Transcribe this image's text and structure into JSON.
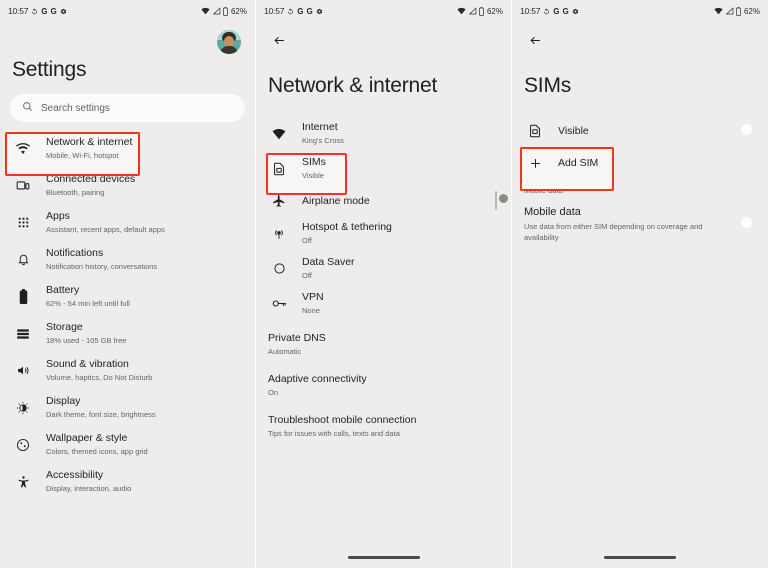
{
  "statusbar": {
    "time": "10:57",
    "battery_pct": "62%",
    "left_icons": [
      "rotate-icon",
      "google-g-icon",
      "google-g-icon",
      "gear-icon"
    ],
    "right_icons": [
      "wifi-icon",
      "signal-icon",
      "battery-icon"
    ]
  },
  "colors": {
    "background": "#eeedeb",
    "highlight_red": "#f4331f",
    "toggle_on": "#3f5257",
    "text_primary": "#1f1f1f",
    "text_secondary": "#636363"
  },
  "screen1": {
    "title": "Settings",
    "search": {
      "placeholder": "Search settings",
      "icon": "search-icon"
    },
    "avatar": "account-avatar",
    "items": [
      {
        "icon": "wifi-icon",
        "title": "Network & internet",
        "subtitle": "Mobile, Wi-Fi, hotspot",
        "highlighted": true
      },
      {
        "icon": "devices-icon",
        "title": "Connected devices",
        "subtitle": "Bluetooth, pairing",
        "highlighted": false
      },
      {
        "icon": "apps-grid-icon",
        "title": "Apps",
        "subtitle": "Assistant, recent apps, default apps",
        "highlighted": false
      },
      {
        "icon": "bell-icon",
        "title": "Notifications",
        "subtitle": "Notification history, conversations",
        "highlighted": false
      },
      {
        "icon": "battery-icon",
        "title": "Battery",
        "subtitle": "62% - 54 min left until full",
        "highlighted": false
      },
      {
        "icon": "storage-icon",
        "title": "Storage",
        "subtitle": "18% used - 105 GB free",
        "highlighted": false
      },
      {
        "icon": "volume-icon",
        "title": "Sound & vibration",
        "subtitle": "Volume, haptics, Do Not Disturb",
        "highlighted": false
      },
      {
        "icon": "brightness-icon",
        "title": "Display",
        "subtitle": "Dark theme, font size, brightness",
        "highlighted": false
      },
      {
        "icon": "palette-icon",
        "title": "Wallpaper & style",
        "subtitle": "Colors, themed icons, app grid",
        "highlighted": false
      },
      {
        "icon": "accessibility-icon",
        "title": "Accessibility",
        "subtitle": "Display, interaction, audio",
        "highlighted": false
      }
    ]
  },
  "screen2": {
    "title": "Network & internet",
    "back_icon": "back-arrow-icon",
    "items": [
      {
        "icon": "wifi-icon",
        "title": "Internet",
        "subtitle": "King's Cross",
        "toggle": null,
        "highlighted": false
      },
      {
        "icon": "sim-card-icon",
        "title": "SIMs",
        "subtitle": "Visible",
        "toggle": null,
        "highlighted": true
      },
      {
        "icon": "airplane-icon",
        "title": "Airplane mode",
        "subtitle": "",
        "toggle": "off",
        "highlighted": false
      },
      {
        "icon": "hotspot-icon",
        "title": "Hotspot & tethering",
        "subtitle": "Off",
        "toggle": null,
        "highlighted": false
      },
      {
        "icon": "data-saver-icon",
        "title": "Data Saver",
        "subtitle": "Off",
        "toggle": null,
        "highlighted": false
      },
      {
        "icon": "vpn-key-icon",
        "title": "VPN",
        "subtitle": "None",
        "toggle": null,
        "highlighted": false
      },
      {
        "icon": null,
        "title": "Private DNS",
        "subtitle": "Automatic",
        "toggle": null,
        "highlighted": false
      },
      {
        "icon": null,
        "title": "Adaptive connectivity",
        "subtitle": "On",
        "toggle": null,
        "highlighted": false
      },
      {
        "icon": null,
        "title": "Troubleshoot mobile connection",
        "subtitle": "Tips for issues with calls, texts and data",
        "toggle": null,
        "highlighted": false
      }
    ]
  },
  "screen3": {
    "title": "SIMs",
    "back_icon": "back-arrow-icon",
    "items": [
      {
        "icon": "sim-card-icon",
        "title": "Visible",
        "subtitle": "",
        "toggle": "on",
        "highlighted": false
      },
      {
        "icon": "plus-icon",
        "title": "Add SIM",
        "subtitle": "",
        "toggle": null,
        "highlighted": true
      }
    ],
    "section_label": "Mobile data",
    "mobile_data": {
      "title": "Mobile data",
      "subtitle": "Use data from either SIM depending on coverage and availability",
      "toggle": "on"
    }
  }
}
